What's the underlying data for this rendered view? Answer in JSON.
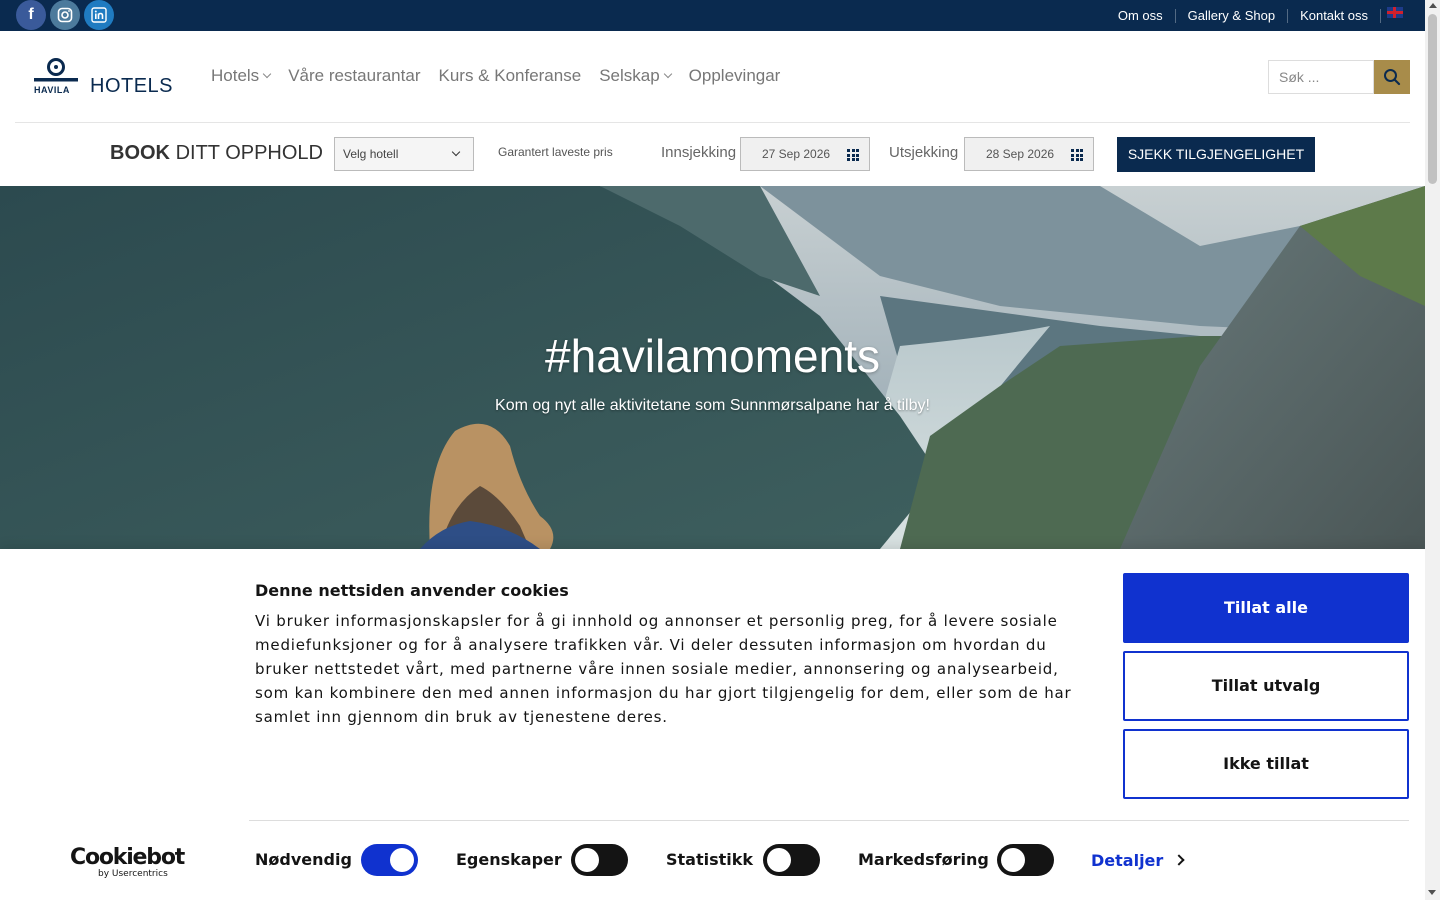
{
  "topbar": {
    "social": [
      {
        "icon": "facebook-icon",
        "glyph": "f"
      },
      {
        "icon": "instagram-icon",
        "glyph": "◎"
      },
      {
        "icon": "linkedin-icon",
        "glyph": "in"
      }
    ],
    "links": [
      "Om oss",
      "Gallery & Shop",
      "Kontakt oss"
    ],
    "language_icon": "uk-flag-icon"
  },
  "header": {
    "logo_small": "HAVILA",
    "logo_text": "HOTELS",
    "nav": [
      "Hotels",
      "Våre restaurantar",
      "Kurs & Konferanse",
      "Selskap",
      "Opplevingar"
    ],
    "search_placeholder": "Søk ..."
  },
  "booking": {
    "title_bold": "BOOK",
    "title_rest": "DITT OPPHOLD",
    "hotel_select": "Velg hotell",
    "guarantee": "Garantert laveste pris",
    "checkin_label": "Innsjekking",
    "checkin_value": "27 Sep 2026",
    "checkout_label": "Utsjekking",
    "checkout_value": "28 Sep 2026",
    "button": "SJEKK TILGJENGELIGHET"
  },
  "hero": {
    "title": "#havilamoments",
    "subtitle": "Kom og nyt alle aktivitetane som Sunnmørsalpane har å tilby!"
  },
  "cookie": {
    "title": "Denne nettsiden anvender cookies",
    "text": "Vi bruker informasjonskapsler for å gi innhold og annonser et personlig preg, for å levere sosiale mediefunksjoner og for å analysere trafikken vår. Vi deler dessuten informasjon om hvordan du bruker nettstedet vårt, med partnerne våre innen sosiale medier, annonsering og analysearbeid, som kan kombinere den med annen informasjon du har gjort tilgjengelig for dem, eller som de har samlet inn gjennom din bruk av tjenestene deres.",
    "allow_all": "Tillat alle",
    "allow_selection": "Tillat utvalg",
    "deny": "Ikke tillat",
    "brand": "Cookiebot",
    "brand_by": "by Usercentrics",
    "toggles": [
      {
        "label": "Nødvendig",
        "on": true
      },
      {
        "label": "Egenskaper",
        "on": false
      },
      {
        "label": "Statistikk",
        "on": false
      },
      {
        "label": "Markedsføring",
        "on": false
      }
    ],
    "details": "Detaljer"
  },
  "colors": {
    "navy": "#0a2a4f",
    "gold": "#a88c4a",
    "cookie_blue": "#1032cf"
  }
}
